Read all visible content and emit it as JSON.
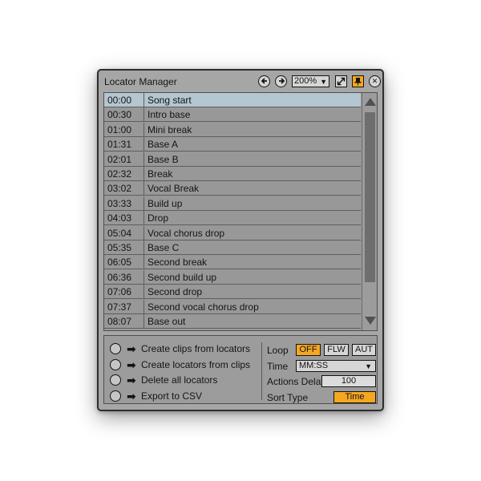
{
  "window": {
    "title": "Locator Manager",
    "zoom": "200%",
    "back_icon": "arrow-left-icon",
    "forward_icon": "arrow-right-icon",
    "close_symbol": "✕"
  },
  "locators": [
    {
      "time": "00:00",
      "name": "Song start",
      "selected": true
    },
    {
      "time": "00:30",
      "name": "Intro base"
    },
    {
      "time": "01:00",
      "name": "Mini break"
    },
    {
      "time": "01:31",
      "name": "Base A"
    },
    {
      "time": "02:01",
      "name": "Base B"
    },
    {
      "time": "02:32",
      "name": "Break"
    },
    {
      "time": "03:02",
      "name": "Vocal Break"
    },
    {
      "time": "03:33",
      "name": "Build up"
    },
    {
      "time": "04:03",
      "name": "Drop"
    },
    {
      "time": "05:04",
      "name": "Vocal chorus drop"
    },
    {
      "time": "05:35",
      "name": "Base C"
    },
    {
      "time": "06:05",
      "name": "Second break"
    },
    {
      "time": "06:36",
      "name": "Second build up"
    },
    {
      "time": "07:06",
      "name": "Second drop"
    },
    {
      "time": "07:37",
      "name": "Second vocal chorus drop"
    },
    {
      "time": "08:07",
      "name": "Base out"
    }
  ],
  "actions": [
    {
      "label": "Create clips from locators"
    },
    {
      "label": "Create locators from clips"
    },
    {
      "label": "Delete all locators"
    },
    {
      "label": "Export to CSV"
    }
  ],
  "options": {
    "loop_label": "Loop",
    "loop_modes": [
      "OFF",
      "FLW",
      "AUT"
    ],
    "loop_active": "OFF",
    "time_label": "Time",
    "time_format": "MM:SS",
    "delay_label": "Actions Delay",
    "delay_value": "100",
    "sort_label": "Sort Type",
    "sort_value": "Time"
  },
  "colors": {
    "accent": "#f5a722",
    "selected_row": "#b4c6d0",
    "panel": "#a6a6a6"
  }
}
